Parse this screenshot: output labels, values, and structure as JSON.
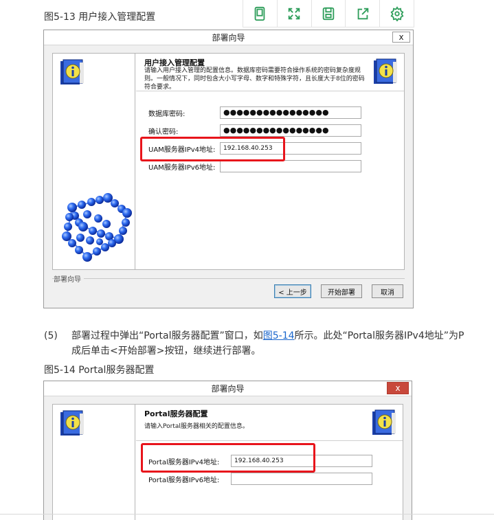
{
  "captions": {
    "fig13": "图5-13 用户接入管理配置",
    "fig14": "图5-14 Portal服务器配置"
  },
  "toolbar": {
    "icons": [
      "tablet-icon",
      "expand-icon",
      "save-icon",
      "share-icon",
      "gear-icon"
    ],
    "color": "#2f9e5b"
  },
  "paragraph": {
    "number": "(5)",
    "text_before_link": "部署过程中弹出“Portal服务器配置”窗口，如",
    "link": "图5-14",
    "text_after_link": "所示。此处“Portal服务器IPv4地址”为P",
    "line2": "成后单击<开始部署>按钮，继续进行部署。"
  },
  "dialog1": {
    "title": "部署向导",
    "close": "x",
    "section_title": "用户接入管理配置",
    "section_desc": "请输入用户接入管理的配置信息。数据库密码需要符合操作系统的密码复杂度规则。一般情况下，同时包含大小写字母、数字和特殊字符，且长度大于8位的密码符合要求。",
    "fields": [
      {
        "label": "数据库密码:",
        "value": "●●●●●●●●●●●●●●●●"
      },
      {
        "label": "确认密码:",
        "value": "●●●●●●●●●●●●●●●●"
      },
      {
        "label": "UAM服务器IPv4地址:",
        "value": "192.168.40.253"
      },
      {
        "label": "UAM服务器IPv6地址:",
        "value": ""
      }
    ],
    "footer_label": "部署向导",
    "buttons": {
      "prev": "< 上一步",
      "start": "开始部署",
      "cancel": "取消"
    }
  },
  "dialog2": {
    "title": "部署向导",
    "close": "x",
    "section_title": "Portal服务器配置",
    "section_desc": "请输入Portal服务器相关的配置信息。",
    "fields": [
      {
        "label": "Portal服务器IPv4地址:",
        "value": "192.168.40.253"
      },
      {
        "label": "Portal服务器IPv6地址:",
        "value": ""
      }
    ]
  },
  "colors": {
    "highlight": "#e8141b",
    "link": "#1a66cc",
    "close_red": "#c8483b"
  }
}
